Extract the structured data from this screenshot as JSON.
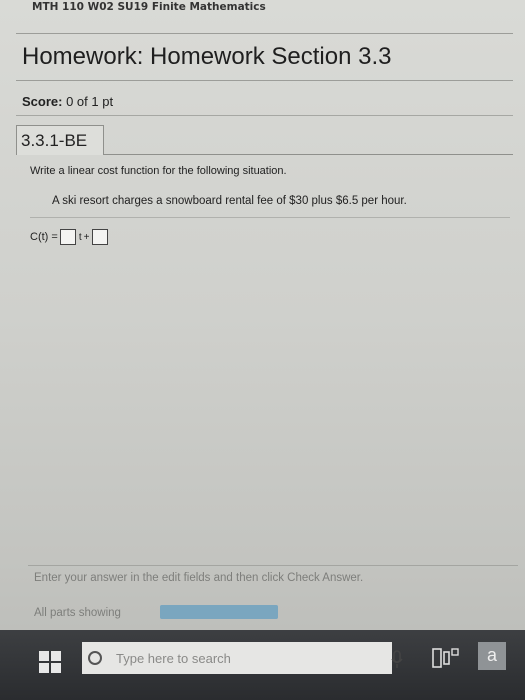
{
  "course": {
    "title": "MTH 110 W02 SU19 Finite Mathematics"
  },
  "homework": {
    "title": "Homework: Homework Section 3.3"
  },
  "score": {
    "label": "Score:",
    "value": "0 of 1 pt"
  },
  "question": {
    "id": "3.3.1-BE",
    "instruction": "Write a linear cost function for the following situation.",
    "problem": "A ski resort charges a snowboard rental fee of $30 plus $6.5 per hour.",
    "formula_lhs": "C(t) =",
    "formula_var": "t",
    "formula_plus": "+",
    "answer_slope": "",
    "answer_intercept": ""
  },
  "footer": {
    "help": "Enter your answer in the edit fields and then click Check Answer.",
    "parts": "All parts showing",
    "progress": 1.0
  },
  "taskbar": {
    "search_placeholder": "Type here to search",
    "amazon_label": "a",
    "icons": [
      "windows-icon",
      "search-icon",
      "microphone-icon",
      "task-view-icon",
      "amazon-icon"
    ]
  },
  "colors": {
    "progress": "#7aa6bf",
    "taskbar": "#2f3134"
  }
}
